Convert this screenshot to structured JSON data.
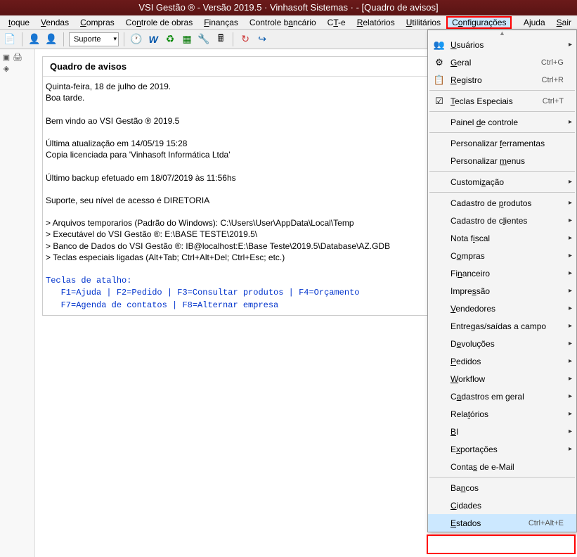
{
  "title": "VSI Gestão ® - Versão 2019.5 · Vinhasoft Sistemas ·  - [Quadro de avisos]",
  "menubar": {
    "items": [
      {
        "pre": "",
        "u": "t",
        "post": "oque"
      },
      {
        "pre": "",
        "u": "V",
        "post": "endas"
      },
      {
        "pre": "",
        "u": "C",
        "post": "ompras"
      },
      {
        "pre": "Co",
        "u": "n",
        "post": "trole de obras"
      },
      {
        "pre": "",
        "u": "F",
        "post": "inanças"
      },
      {
        "pre": "Controle b",
        "u": "a",
        "post": "ncário"
      },
      {
        "pre": "C",
        "u": "T",
        "post": "-e"
      },
      {
        "pre": "",
        "u": "R",
        "post": "elatórios"
      },
      {
        "pre": "",
        "u": "U",
        "post": "tilitários"
      }
    ],
    "config": {
      "pre": "C",
      "u": "o",
      "post": "nfigurações"
    },
    "right": [
      {
        "pre": "A",
        "u": "j",
        "post": "uda"
      },
      {
        "pre": "",
        "u": "S",
        "post": "air"
      }
    ]
  },
  "toolbar": {
    "suporte_label": "Suporte"
  },
  "panel": {
    "title": "Quadro de avisos",
    "body": "Quinta-feira, 18 de julho de 2019.\nBoa tarde.\n\nBem vindo ao VSI Gestão ® 2019.5\n\nÚltima atualização em 14/05/19 15:28\nCopia licenciada para 'Vinhasoft Informática Ltda'\n\nÚltimo backup efetuado em 18/07/2019 às 11:56hs\n\nSuporte, seu nível de acesso é DIRETORIA\n\n> Arquivos temporarios (Padrão do Windows): C:\\Users\\User\\AppData\\Local\\Temp\n> Executável do VSI Gestão ®: E:\\BASE TESTE\\2019.5\\\n> Banco de Dados do VSI Gestão ®: IB@localhost:E:\\Base Teste\\2019.5\\Database\\AZ.GDB\n> Teclas especiais ligadas (Alt+Tab; Ctrl+Alt+Del; Ctrl+Esc; etc.)",
    "shortcuts_title": "Teclas de atalho:",
    "shortcuts_line1": "   F1=Ajuda | F2=Pedido | F3=Consultar produtos | F4=Orçamento",
    "shortcuts_line2": "   F7=Agenda de contatos | F8=Alternar empresa"
  },
  "dropdown": {
    "items": [
      {
        "icon": "👥",
        "pre": "",
        "u": "U",
        "post": "suários",
        "shortcut": "",
        "sub": true
      },
      {
        "icon": "⚙",
        "pre": "",
        "u": "G",
        "post": "eral",
        "shortcut": "Ctrl+G",
        "sub": false
      },
      {
        "icon": "📋",
        "pre": "",
        "u": "R",
        "post": "egistro",
        "shortcut": "Ctrl+R",
        "sub": false
      },
      {
        "sep": true
      },
      {
        "icon": "☑",
        "pre": "",
        "u": "T",
        "post": "eclas Especiais",
        "shortcut": "Ctrl+T",
        "sub": false
      },
      {
        "sep": true
      },
      {
        "icon": "",
        "pre": "Painel ",
        "u": "d",
        "post": "e controle",
        "shortcut": "",
        "sub": true
      },
      {
        "sep": true
      },
      {
        "icon": "",
        "pre": "Personalizar ",
        "u": "f",
        "post": "erramentas",
        "shortcut": "",
        "sub": false
      },
      {
        "icon": "",
        "pre": "Personalizar ",
        "u": "m",
        "post": "enus",
        "shortcut": "",
        "sub": false
      },
      {
        "sep": true
      },
      {
        "icon": "",
        "pre": "Customi",
        "u": "z",
        "post": "ação",
        "shortcut": "",
        "sub": true
      },
      {
        "sep": true
      },
      {
        "icon": "",
        "pre": "Cadastro de ",
        "u": "p",
        "post": "rodutos",
        "shortcut": "",
        "sub": true
      },
      {
        "icon": "",
        "pre": "Cadastro de c",
        "u": "l",
        "post": "ientes",
        "shortcut": "",
        "sub": true
      },
      {
        "icon": "",
        "pre": "Nota f",
        "u": "i",
        "post": "scal",
        "shortcut": "",
        "sub": true
      },
      {
        "icon": "",
        "pre": "C",
        "u": "o",
        "post": "mpras",
        "shortcut": "",
        "sub": true
      },
      {
        "icon": "",
        "pre": "Fi",
        "u": "n",
        "post": "anceiro",
        "shortcut": "",
        "sub": true
      },
      {
        "icon": "",
        "pre": "Impre",
        "u": "s",
        "post": "são",
        "shortcut": "",
        "sub": true
      },
      {
        "icon": "",
        "pre": "",
        "u": "V",
        "post": "endedores",
        "shortcut": "",
        "sub": true
      },
      {
        "icon": "",
        "pre": "Entre",
        "u": "g",
        "post": "as/saídas a campo",
        "shortcut": "",
        "sub": true
      },
      {
        "icon": "",
        "pre": "D",
        "u": "e",
        "post": "voluções",
        "shortcut": "",
        "sub": true
      },
      {
        "icon": "",
        "pre": "",
        "u": "P",
        "post": "edidos",
        "shortcut": "",
        "sub": true
      },
      {
        "icon": "",
        "pre": "",
        "u": "W",
        "post": "orkflow",
        "shortcut": "",
        "sub": true
      },
      {
        "icon": "",
        "pre": "C",
        "u": "a",
        "post": "dastros em geral",
        "shortcut": "",
        "sub": true
      },
      {
        "icon": "",
        "pre": "Rela",
        "u": "t",
        "post": "órios",
        "shortcut": "",
        "sub": true
      },
      {
        "icon": "",
        "pre": "",
        "u": "B",
        "post": "I",
        "shortcut": "",
        "sub": true
      },
      {
        "icon": "",
        "pre": "E",
        "u": "x",
        "post": "portações",
        "shortcut": "",
        "sub": true
      },
      {
        "icon": "",
        "pre": "Conta",
        "u": "s",
        "post": " de e-Mail",
        "shortcut": "",
        "sub": false
      },
      {
        "sep": true
      },
      {
        "icon": "",
        "pre": "Ba",
        "u": "n",
        "post": "cos",
        "shortcut": "",
        "sub": false
      },
      {
        "icon": "",
        "pre": "",
        "u": "C",
        "post": "idades",
        "shortcut": "",
        "sub": false
      },
      {
        "icon": "",
        "pre": "",
        "u": "E",
        "post": "stados",
        "shortcut": "Ctrl+Alt+E",
        "sub": false,
        "highlighted": true
      }
    ]
  }
}
